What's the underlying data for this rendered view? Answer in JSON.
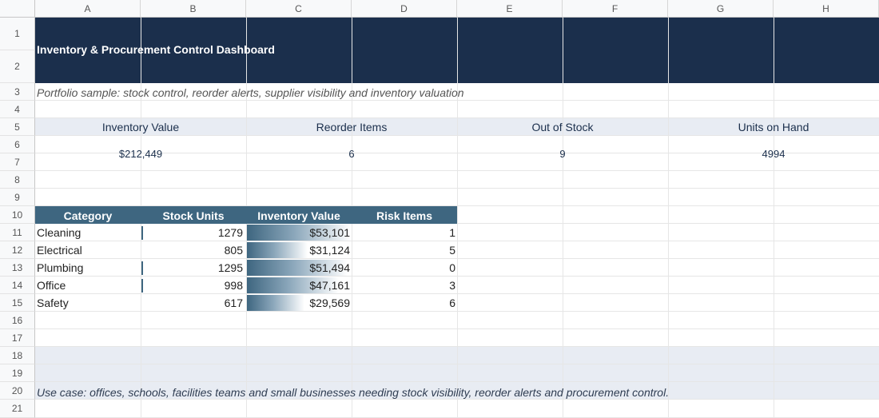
{
  "sheet": {
    "columns": [
      "A",
      "B",
      "C",
      "D",
      "E",
      "F",
      "G",
      "H"
    ],
    "rows": [
      "1",
      "2",
      "3",
      "4",
      "5",
      "6",
      "7",
      "8",
      "9",
      "10",
      "11",
      "12",
      "13",
      "14",
      "15",
      "16",
      "17",
      "18",
      "19",
      "20",
      "21"
    ]
  },
  "header": {
    "title": "Inventory & Procurement Control Dashboard",
    "subtitle": "Portfolio sample: stock control, reorder alerts, supplier visibility and inventory valuation"
  },
  "kpis": [
    {
      "label": "Inventory Value",
      "value": "$212,449"
    },
    {
      "label": "Reorder Items",
      "value": "6"
    },
    {
      "label": "Out of Stock",
      "value": "9"
    },
    {
      "label": "Units on Hand",
      "value": "4994"
    }
  ],
  "table": {
    "headers": [
      "Category",
      "Stock Units",
      "Inventory Value",
      "Risk Items"
    ],
    "rows": [
      {
        "category": "Cleaning",
        "units": "1279",
        "value": "$53,101",
        "risk": "1",
        "units_num": 1279,
        "value_num": 53101
      },
      {
        "category": "Electrical",
        "units": "805",
        "value": "$31,124",
        "risk": "5",
        "units_num": 805,
        "value_num": 31124
      },
      {
        "category": "Plumbing",
        "units": "1295",
        "value": "$51,494",
        "risk": "0",
        "units_num": 1295,
        "value_num": 51494
      },
      {
        "category": "Office",
        "units": "998",
        "value": "$47,161",
        "risk": "3",
        "units_num": 998,
        "value_num": 47161
      },
      {
        "category": "Safety",
        "units": "617",
        "value": "$29,569",
        "risk": "6",
        "units_num": 617,
        "value_num": 29569
      }
    ]
  },
  "footer": {
    "use_case": "Use case: offices, schools, facilities teams and small businesses needing stock visibility, reorder alerts and procurement control."
  },
  "colors": {
    "title_band": "#1b2f4c",
    "table_header": "#3e6680",
    "light_band": "#e8ecf3"
  }
}
